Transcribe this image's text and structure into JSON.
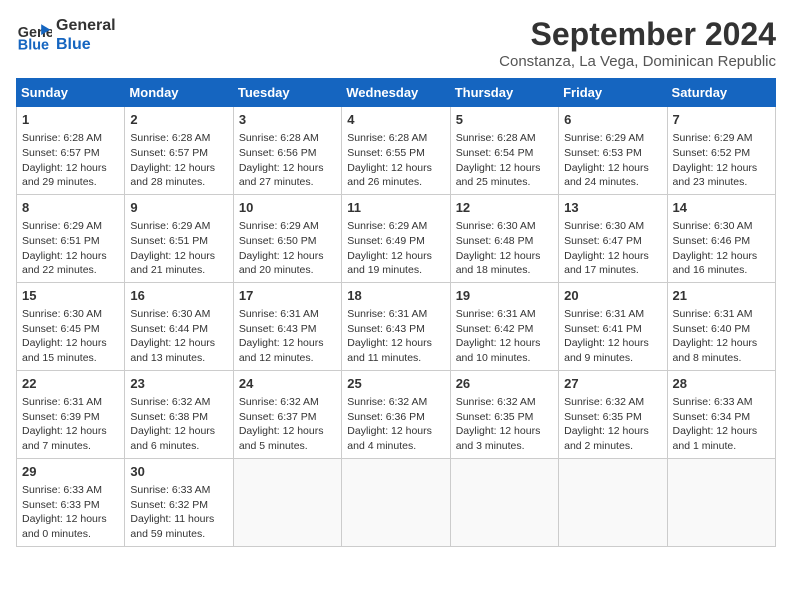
{
  "logo": {
    "line1": "General",
    "line2": "Blue"
  },
  "title": "September 2024",
  "subtitle": "Constanza, La Vega, Dominican Republic",
  "weekdays": [
    "Sunday",
    "Monday",
    "Tuesday",
    "Wednesday",
    "Thursday",
    "Friday",
    "Saturday"
  ],
  "days": [
    {
      "num": "",
      "info": ""
    },
    {
      "num": "",
      "info": ""
    },
    {
      "num": "",
      "info": ""
    },
    {
      "num": "",
      "info": ""
    },
    {
      "num": "",
      "info": ""
    },
    {
      "num": "",
      "info": ""
    },
    {
      "num": "",
      "info": ""
    },
    {
      "num": "1",
      "info": "Sunrise: 6:28 AM\nSunset: 6:57 PM\nDaylight: 12 hours\nand 29 minutes."
    },
    {
      "num": "2",
      "info": "Sunrise: 6:28 AM\nSunset: 6:57 PM\nDaylight: 12 hours\nand 28 minutes."
    },
    {
      "num": "3",
      "info": "Sunrise: 6:28 AM\nSunset: 6:56 PM\nDaylight: 12 hours\nand 27 minutes."
    },
    {
      "num": "4",
      "info": "Sunrise: 6:28 AM\nSunset: 6:55 PM\nDaylight: 12 hours\nand 26 minutes."
    },
    {
      "num": "5",
      "info": "Sunrise: 6:28 AM\nSunset: 6:54 PM\nDaylight: 12 hours\nand 25 minutes."
    },
    {
      "num": "6",
      "info": "Sunrise: 6:29 AM\nSunset: 6:53 PM\nDaylight: 12 hours\nand 24 minutes."
    },
    {
      "num": "7",
      "info": "Sunrise: 6:29 AM\nSunset: 6:52 PM\nDaylight: 12 hours\nand 23 minutes."
    },
    {
      "num": "8",
      "info": "Sunrise: 6:29 AM\nSunset: 6:51 PM\nDaylight: 12 hours\nand 22 minutes."
    },
    {
      "num": "9",
      "info": "Sunrise: 6:29 AM\nSunset: 6:51 PM\nDaylight: 12 hours\nand 21 minutes."
    },
    {
      "num": "10",
      "info": "Sunrise: 6:29 AM\nSunset: 6:50 PM\nDaylight: 12 hours\nand 20 minutes."
    },
    {
      "num": "11",
      "info": "Sunrise: 6:29 AM\nSunset: 6:49 PM\nDaylight: 12 hours\nand 19 minutes."
    },
    {
      "num": "12",
      "info": "Sunrise: 6:30 AM\nSunset: 6:48 PM\nDaylight: 12 hours\nand 18 minutes."
    },
    {
      "num": "13",
      "info": "Sunrise: 6:30 AM\nSunset: 6:47 PM\nDaylight: 12 hours\nand 17 minutes."
    },
    {
      "num": "14",
      "info": "Sunrise: 6:30 AM\nSunset: 6:46 PM\nDaylight: 12 hours\nand 16 minutes."
    },
    {
      "num": "15",
      "info": "Sunrise: 6:30 AM\nSunset: 6:45 PM\nDaylight: 12 hours\nand 15 minutes."
    },
    {
      "num": "16",
      "info": "Sunrise: 6:30 AM\nSunset: 6:44 PM\nDaylight: 12 hours\nand 13 minutes."
    },
    {
      "num": "17",
      "info": "Sunrise: 6:31 AM\nSunset: 6:43 PM\nDaylight: 12 hours\nand 12 minutes."
    },
    {
      "num": "18",
      "info": "Sunrise: 6:31 AM\nSunset: 6:43 PM\nDaylight: 12 hours\nand 11 minutes."
    },
    {
      "num": "19",
      "info": "Sunrise: 6:31 AM\nSunset: 6:42 PM\nDaylight: 12 hours\nand 10 minutes."
    },
    {
      "num": "20",
      "info": "Sunrise: 6:31 AM\nSunset: 6:41 PM\nDaylight: 12 hours\nand 9 minutes."
    },
    {
      "num": "21",
      "info": "Sunrise: 6:31 AM\nSunset: 6:40 PM\nDaylight: 12 hours\nand 8 minutes."
    },
    {
      "num": "22",
      "info": "Sunrise: 6:31 AM\nSunset: 6:39 PM\nDaylight: 12 hours\nand 7 minutes."
    },
    {
      "num": "23",
      "info": "Sunrise: 6:32 AM\nSunset: 6:38 PM\nDaylight: 12 hours\nand 6 minutes."
    },
    {
      "num": "24",
      "info": "Sunrise: 6:32 AM\nSunset: 6:37 PM\nDaylight: 12 hours\nand 5 minutes."
    },
    {
      "num": "25",
      "info": "Sunrise: 6:32 AM\nSunset: 6:36 PM\nDaylight: 12 hours\nand 4 minutes."
    },
    {
      "num": "26",
      "info": "Sunrise: 6:32 AM\nSunset: 6:35 PM\nDaylight: 12 hours\nand 3 minutes."
    },
    {
      "num": "27",
      "info": "Sunrise: 6:32 AM\nSunset: 6:35 PM\nDaylight: 12 hours\nand 2 minutes."
    },
    {
      "num": "28",
      "info": "Sunrise: 6:33 AM\nSunset: 6:34 PM\nDaylight: 12 hours\nand 1 minute."
    },
    {
      "num": "29",
      "info": "Sunrise: 6:33 AM\nSunset: 6:33 PM\nDaylight: 12 hours\nand 0 minutes."
    },
    {
      "num": "30",
      "info": "Sunrise: 6:33 AM\nSunset: 6:32 PM\nDaylight: 11 hours\nand 59 minutes."
    },
    {
      "num": "",
      "info": ""
    },
    {
      "num": "",
      "info": ""
    },
    {
      "num": "",
      "info": ""
    },
    {
      "num": "",
      "info": ""
    },
    {
      "num": "",
      "info": ""
    }
  ]
}
